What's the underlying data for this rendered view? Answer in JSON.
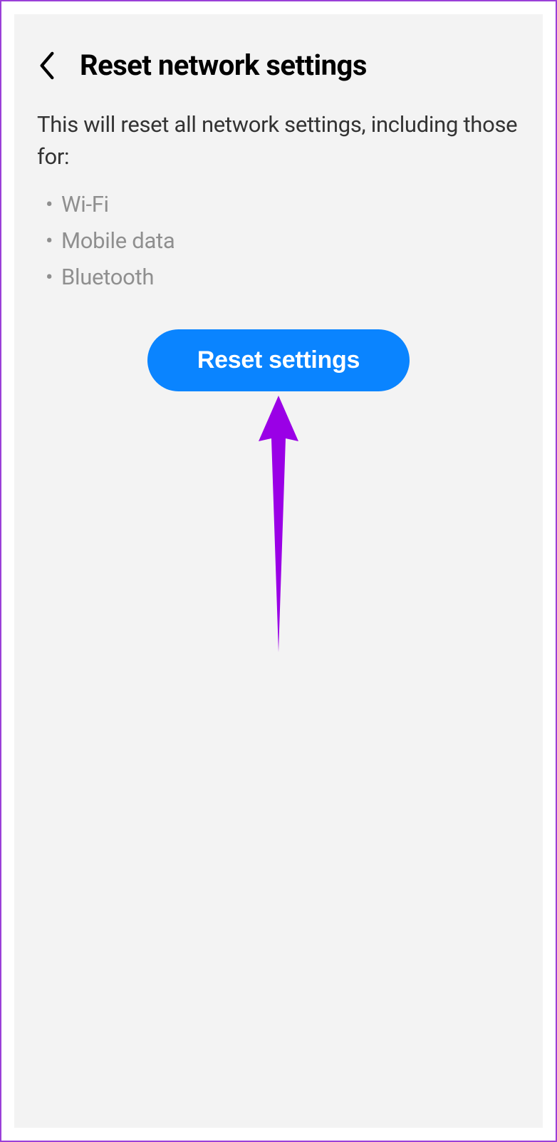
{
  "header": {
    "title": "Reset network settings"
  },
  "body": {
    "description": "This will reset all network settings, including those for:",
    "items": {
      "0": "Wi-Fi",
      "1": "Mobile data",
      "2": "Bluetooth"
    },
    "reset_button_label": "Reset settings"
  },
  "colors": {
    "accent": "#0A84FF",
    "annotation": "#9a00e6"
  }
}
